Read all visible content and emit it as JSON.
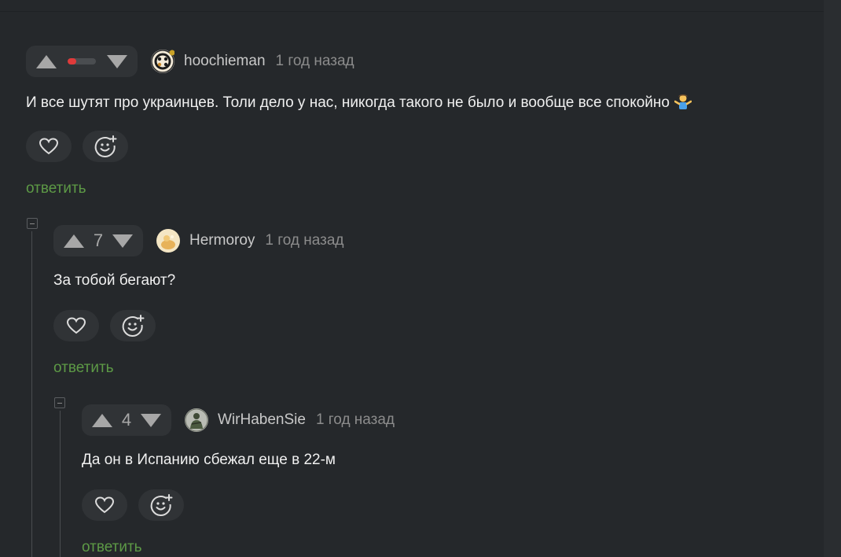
{
  "comments": [
    {
      "username": "hoochieman",
      "time": "1 год назад",
      "rating_negative_fraction": 0.3,
      "text": "И все шутят про украинцев. Толи дело у нас, никогда такого не было и вообще все спокойно",
      "emoji": "shrug-person-emoji",
      "reply_label": "ответить"
    },
    {
      "username": "Hermoroy",
      "time": "1 год назад",
      "score": "7",
      "text": "За тобой бегают?",
      "reply_label": "ответить"
    },
    {
      "username": "WirHabenSie",
      "time": "1 год назад",
      "score": "4",
      "text": "Да он в Испанию сбежал еще в 22-м",
      "reply_label": "ответить"
    }
  ],
  "icons": {
    "like": "heart-icon",
    "reaction": "add-reaction-icon",
    "upvote": "upvote-arrow-icon",
    "downvote": "downvote-arrow-icon",
    "collapse": "collapse-thread-icon"
  },
  "colors": {
    "background": "#25282b",
    "reply_link": "#5d9a46",
    "negative_rating": "#e03a3a"
  }
}
